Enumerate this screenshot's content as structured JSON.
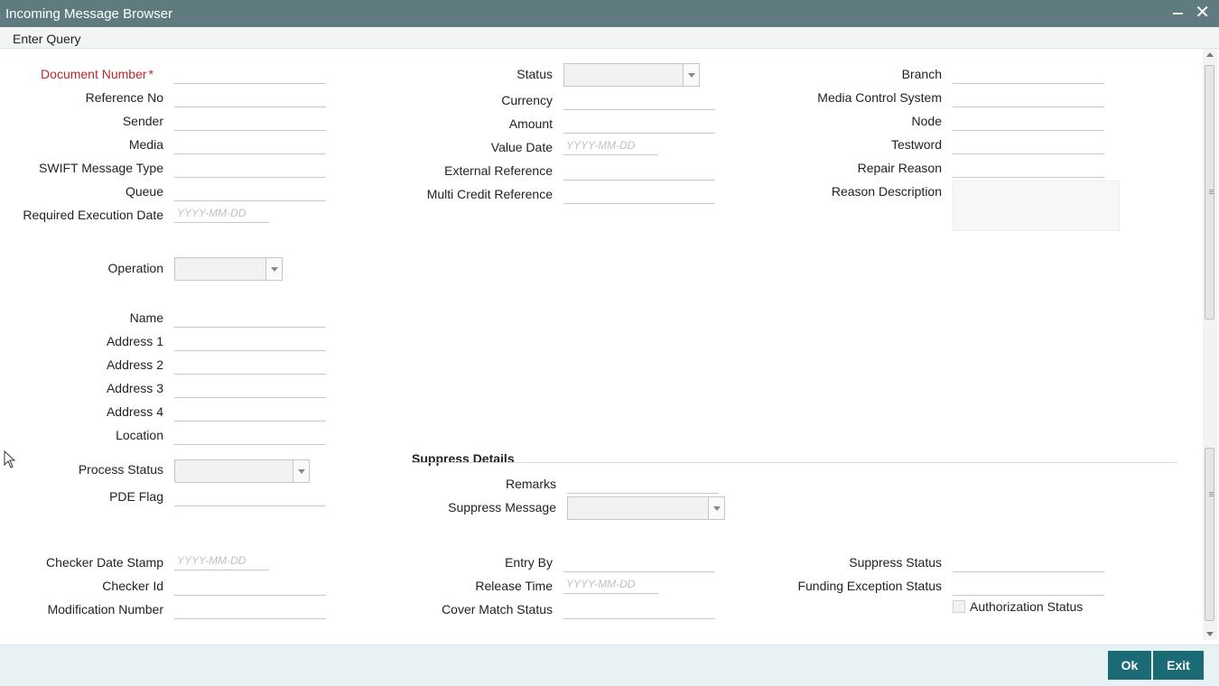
{
  "window": {
    "title": "Incoming Message Browser"
  },
  "menu": {
    "enter_query": "Enter Query"
  },
  "left": {
    "document_number": "Document Number",
    "reference_no": "Reference No",
    "sender": "Sender",
    "media": "Media",
    "swift_message_type": "SWIFT Message Type",
    "queue": "Queue",
    "required_execution_date": "Required Execution Date",
    "operation": "Operation",
    "name": "Name",
    "address1": "Address 1",
    "address2": "Address 2",
    "address3": "Address 3",
    "address4": "Address 4",
    "location": "Location",
    "process_status": "Process Status",
    "pde_flag": "PDE Flag",
    "checker_date_stamp": "Checker Date Stamp",
    "checker_id": "Checker Id",
    "modification_number": "Modification Number"
  },
  "middle": {
    "status": "Status",
    "currency": "Currency",
    "amount": "Amount",
    "value_date": "Value Date",
    "external_reference": "External Reference",
    "multi_credit_reference": "Multi Credit Reference",
    "entry_by": "Entry By",
    "release_time": "Release Time",
    "cover_match_status": "Cover Match Status"
  },
  "right": {
    "branch": "Branch",
    "media_control_system": "Media Control System",
    "node": "Node",
    "testword": "Testword",
    "repair_reason": "Repair Reason",
    "reason_description": "Reason Description",
    "suppress_status": "Suppress Status",
    "funding_exception_status": "Funding Exception Status",
    "authorization_status": "Authorization Status"
  },
  "suppress": {
    "heading": "Suppress Details",
    "remarks": "Remarks",
    "suppress_message": "Suppress Message"
  },
  "date_placeholder": "YYYY-MM-DD",
  "buttons": {
    "ok": "Ok",
    "exit": "Exit"
  }
}
